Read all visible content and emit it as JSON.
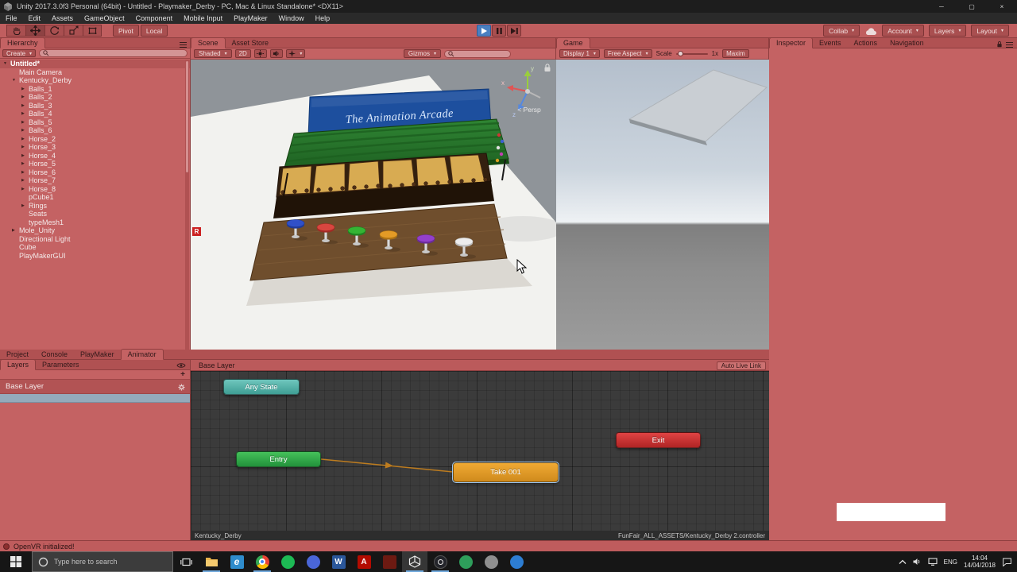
{
  "colors": {
    "playmode_tint": "#c46263",
    "accent_blue": "#4a7fc1",
    "node_any_state": "#49b8ac",
    "node_entry": "#2fae4c",
    "node_take": "#e9a02f",
    "node_exit": "#cf3a32"
  },
  "window": {
    "title": "Unity 2017.3.0f3 Personal (64bit) - Untitled - Playmaker_Derby - PC, Mac & Linux Standalone* <DX11>",
    "menus": [
      "File",
      "Edit",
      "Assets",
      "GameObject",
      "Component",
      "Mobile Input",
      "PlayMaker",
      "Window",
      "Help"
    ],
    "controls": {
      "minimize": "─",
      "maximize": "▢",
      "close": "×"
    }
  },
  "toolbar": {
    "pivot": "Pivot",
    "local": "Local",
    "collab": "Collab",
    "account": "Account",
    "layers": "Layers",
    "layout": "Layout"
  },
  "hierarchy": {
    "tab": "Hierarchy",
    "create": "Create",
    "items": [
      {
        "label": "Untitled*"
      },
      {
        "label": "Main Camera"
      },
      {
        "label": "Kentucky_Derby"
      },
      {
        "label": "Balls_1"
      },
      {
        "label": "Balls_2"
      },
      {
        "label": "Balls_3"
      },
      {
        "label": "Balls_4"
      },
      {
        "label": "Balls_5"
      },
      {
        "label": "Balls_6"
      },
      {
        "label": "Horse_2"
      },
      {
        "label": "Horse_3"
      },
      {
        "label": "Horse_4"
      },
      {
        "label": "Horse_5"
      },
      {
        "label": "Horse_6"
      },
      {
        "label": "Horse_7"
      },
      {
        "label": "Horse_8"
      },
      {
        "label": "pCube1"
      },
      {
        "label": "Rings"
      },
      {
        "label": "Seats"
      },
      {
        "label": "typeMesh1"
      },
      {
        "label": "Mole_Unity"
      },
      {
        "label": "Directional Light"
      },
      {
        "label": "Cube"
      },
      {
        "label": "PlayMakerGUI"
      }
    ]
  },
  "scene": {
    "tab": "Scene",
    "asset_store_tab": "Asset Store",
    "shaded": "Shaded",
    "mode_2d": "2D",
    "gizmos": "Gizmos",
    "persp": "< Persp",
    "axis": {
      "x": "x",
      "y": "y",
      "z": "z"
    },
    "sign_text": "The Animation Arcade",
    "recording_badge": "R"
  },
  "game": {
    "tab": "Game",
    "display": "Display 1",
    "aspect": "Free Aspect",
    "scale_label": "Scale",
    "scale_value": "1x",
    "maximize": "Maxim"
  },
  "inspector": {
    "tabs": [
      "Inspector",
      "Events",
      "Actions",
      "Navigation"
    ]
  },
  "bottom_tabs": [
    "Project",
    "Console",
    "PlayMaker",
    "Animator"
  ],
  "animator": {
    "layers_tab": "Layers",
    "parameters_tab": "Parameters",
    "add_label": "+",
    "base_layer": "Base Layer",
    "breadcrumb": "Base Layer",
    "auto_live_link": "Auto Live Link",
    "nodes": [
      {
        "label": "Any State"
      },
      {
        "label": "Entry"
      },
      {
        "label": "Take 001"
      },
      {
        "label": "Exit"
      }
    ],
    "status_left": "Kentucky_Derby",
    "status_right": "FunFair_ALL_ASSETS/Kentucky_Derby 2.controller"
  },
  "status_bar": {
    "message": "OpenVR initialized!"
  },
  "taskbar": {
    "search_placeholder": "Type here to search",
    "apps": [
      {
        "name": "file-explorer",
        "glyph": ""
      },
      {
        "name": "edge",
        "glyph": "e"
      },
      {
        "name": "chrome",
        "glyph": ""
      },
      {
        "name": "spotify",
        "glyph": ""
      },
      {
        "name": "app-blue",
        "glyph": ""
      },
      {
        "name": "word",
        "glyph": "W"
      },
      {
        "name": "acrobat",
        "glyph": "A"
      },
      {
        "name": "app-dark-red",
        "glyph": ""
      },
      {
        "name": "unity",
        "glyph": ""
      },
      {
        "name": "obs",
        "glyph": ""
      },
      {
        "name": "app-green",
        "glyph": ""
      },
      {
        "name": "app-gray",
        "glyph": ""
      },
      {
        "name": "app-blue-2",
        "glyph": ""
      }
    ],
    "tray": {
      "language": "ENG",
      "time": "14:04",
      "date": "14/04/2018"
    }
  }
}
